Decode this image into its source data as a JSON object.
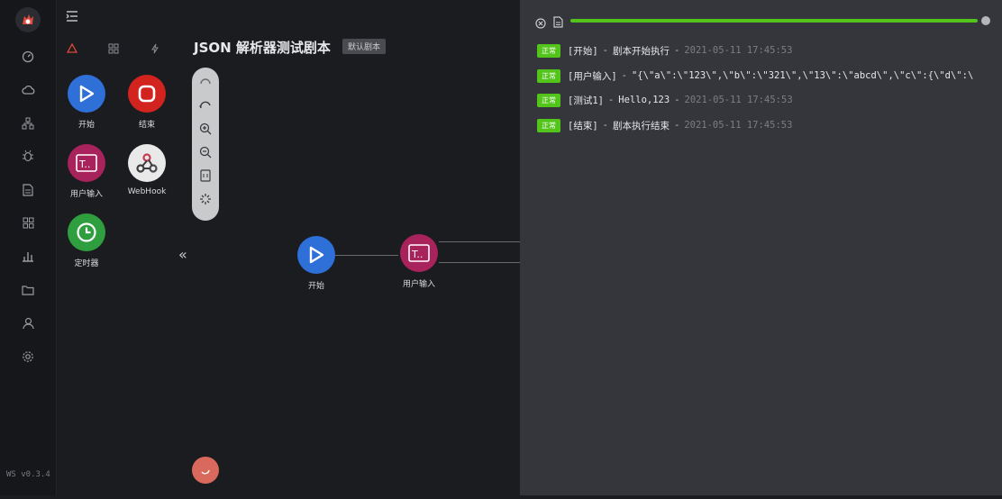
{
  "app": {
    "version": "WS v0.3.4",
    "title": "JSON 解析器测试剧本",
    "badge": "默认剧本"
  },
  "toolbox": {
    "nodes": [
      {
        "label": "开始",
        "icon": "play-icon",
        "color": "#2f6fd8"
      },
      {
        "label": "结束",
        "icon": "stop-icon",
        "color": "#d2231f"
      },
      {
        "label": "用户输入",
        "icon": "terminal-icon",
        "color": "#a8225c"
      },
      {
        "label": "WebHook",
        "icon": "webhook-icon",
        "color": "#e9e9ea"
      },
      {
        "label": "定时器",
        "icon": "clock-icon",
        "color": "#2e9e3e"
      }
    ]
  },
  "canvas": {
    "nodes": [
      {
        "label": "开始",
        "icon": "play-icon",
        "color": "#2f6fd8"
      },
      {
        "label": "用户输入",
        "icon": "terminal-icon",
        "color": "#a8225c"
      }
    ]
  },
  "logs": {
    "progress_percent": 100,
    "accent": "#52c41a",
    "entries": [
      {
        "status": "正常",
        "step": "[开始]",
        "message": "剧本开始执行",
        "time": "2021-05-11 17:45:53"
      },
      {
        "status": "正常",
        "step": "[用户输入]",
        "message": "\"{\\\"a\\\":\\\"123\\\",\\\"b\\\":\\\"321\\\",\\\"13\\\":\\\"abcd\\\",\\\"c\\\":{\\\"d\\\":\\",
        "time": ""
      },
      {
        "status": "正常",
        "step": "[测试1]",
        "message": "Hello,123",
        "time": "2021-05-11 17:45:53"
      },
      {
        "status": "正常",
        "step": "[结束]",
        "message": "剧本执行结束",
        "time": "2021-05-11 17:45:53"
      }
    ]
  }
}
